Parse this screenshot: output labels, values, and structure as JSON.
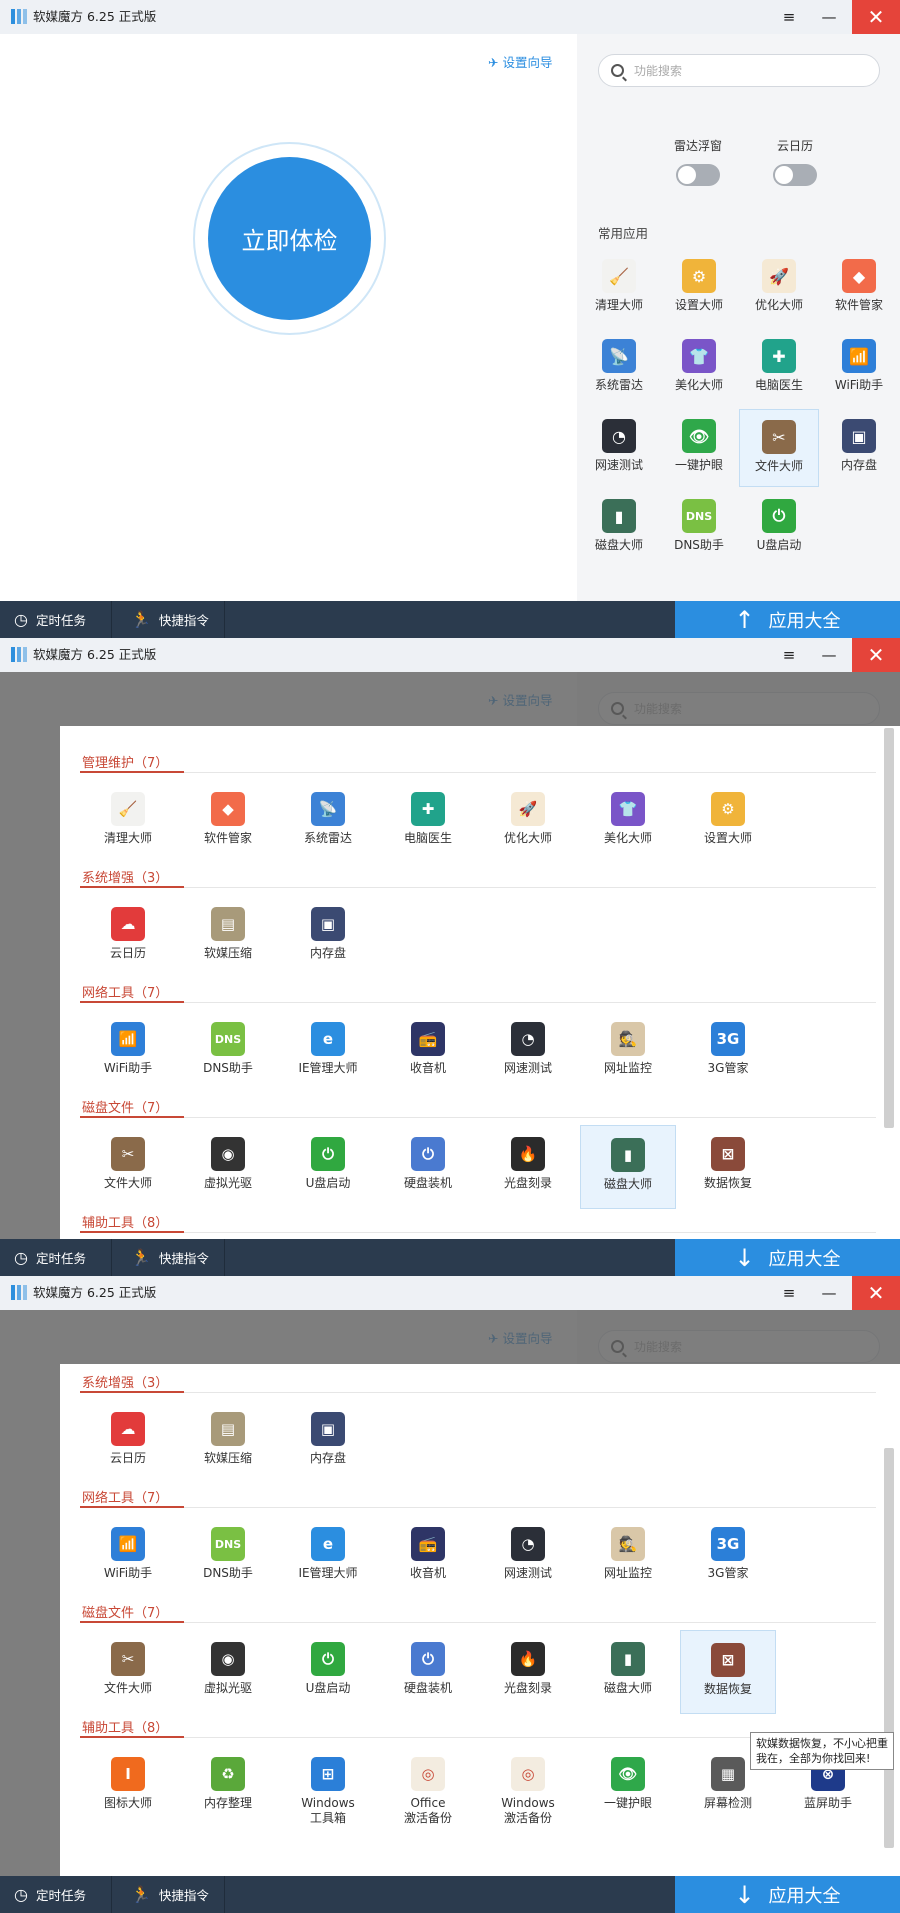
{
  "app": {
    "title": "软媒魔方 6.25 正式版",
    "menu_icon": "≡",
    "min_icon": "—",
    "close_icon": "✕"
  },
  "bottom": {
    "timer": "定时任务",
    "quick": "快捷指令",
    "apps": "应用大全"
  },
  "home": {
    "settings_guide": "设置向导",
    "search_placeholder": "功能搜索",
    "check_button": "立即体检",
    "toggles": [
      {
        "label": "雷达浮窗"
      },
      {
        "label": "云日历"
      }
    ],
    "common_label": "常用应用",
    "common_apps": [
      {
        "label": "清理大师",
        "icon": "broom-icon",
        "color": "#f2f2f0",
        "glyph": "🧹"
      },
      {
        "label": "设置大师",
        "icon": "gear-icon",
        "color": "#f0b43a",
        "glyph": "⚙"
      },
      {
        "label": "优化大师",
        "icon": "rocket-icon",
        "color": "#f5e9d4",
        "glyph": "🚀"
      },
      {
        "label": "软件管家",
        "icon": "diamond-icon",
        "color": "#f26b4a",
        "glyph": "◆"
      },
      {
        "label": "系统雷达",
        "icon": "satellite-icon",
        "color": "#3c82d6",
        "glyph": "📡"
      },
      {
        "label": "美化大师",
        "icon": "tshirt-icon",
        "color": "#7a55c8",
        "glyph": "👕"
      },
      {
        "label": "电脑医生",
        "icon": "medkit-icon",
        "color": "#21a38b",
        "glyph": "✚"
      },
      {
        "label": "WiFi助手",
        "icon": "wifi-icon",
        "color": "#2e7fd8",
        "glyph": "📶"
      },
      {
        "label": "网速测试",
        "icon": "speedometer-icon",
        "color": "#2b2f38",
        "glyph": "◔"
      },
      {
        "label": "一键护眼",
        "icon": "eye-icon",
        "color": "#2fa84a",
        "glyph": "👁"
      },
      {
        "label": "文件大师",
        "icon": "scissors-icon",
        "color": "#8a6a4a",
        "glyph": "✂"
      },
      {
        "label": "内存盘",
        "icon": "chip-icon",
        "color": "#3b4a72",
        "glyph": "▣"
      },
      {
        "label": "磁盘大师",
        "icon": "disk-icon",
        "color": "#3b6f58",
        "glyph": "▮"
      },
      {
        "label": "DNS助手",
        "icon": "dns-icon",
        "color": "#7ac043",
        "glyph": "DNS"
      },
      {
        "label": "U盘启动",
        "icon": "usb-icon",
        "color": "#30a840",
        "glyph": "⏻"
      }
    ]
  },
  "sections": [
    {
      "title": "管理维护（7）",
      "apps": [
        {
          "label": "清理大师",
          "icon": "broom-icon",
          "color": "#f2f2f0",
          "glyph": "🧹"
        },
        {
          "label": "软件管家",
          "icon": "diamond-icon",
          "color": "#f26b4a",
          "glyph": "◆"
        },
        {
          "label": "系统雷达",
          "icon": "satellite-icon",
          "color": "#3c82d6",
          "glyph": "📡"
        },
        {
          "label": "电脑医生",
          "icon": "medkit-icon",
          "color": "#21a38b",
          "glyph": "✚"
        },
        {
          "label": "优化大师",
          "icon": "rocket-icon",
          "color": "#f5e9d4",
          "glyph": "🚀"
        },
        {
          "label": "美化大师",
          "icon": "tshirt-icon",
          "color": "#7a55c8",
          "glyph": "👕"
        },
        {
          "label": "设置大师",
          "icon": "gear-icon",
          "color": "#f0b43a",
          "glyph": "⚙"
        }
      ]
    },
    {
      "title": "系统增强（3）",
      "apps": [
        {
          "label": "云日历",
          "icon": "cloud-calendar-icon",
          "color": "#e23b3b",
          "glyph": "☁"
        },
        {
          "label": "软媒压缩",
          "icon": "archive-icon",
          "color": "#a89a7a",
          "glyph": "▤"
        },
        {
          "label": "内存盘",
          "icon": "chip-icon",
          "color": "#3b4a72",
          "glyph": "▣"
        }
      ]
    },
    {
      "title": "网络工具（7）",
      "apps": [
        {
          "label": "WiFi助手",
          "icon": "wifi-icon",
          "color": "#2e7fd8",
          "glyph": "📶"
        },
        {
          "label": "DNS助手",
          "icon": "dns-icon",
          "color": "#7ac043",
          "glyph": "DNS"
        },
        {
          "label": "IE管理大师",
          "icon": "ie-icon",
          "color": "#2b8ee0",
          "glyph": "e"
        },
        {
          "label": "收音机",
          "icon": "radio-icon",
          "color": "#2e3566",
          "glyph": "📻"
        },
        {
          "label": "网速测试",
          "icon": "speedometer-icon",
          "color": "#2b2f38",
          "glyph": "◔"
        },
        {
          "label": "网址监控",
          "icon": "spy-icon",
          "color": "#d9c7a8",
          "glyph": "🕵"
        },
        {
          "label": "3G管家",
          "icon": "3g-icon",
          "color": "#2b7fd8",
          "glyph": "3G"
        }
      ]
    },
    {
      "title": "磁盘文件（7）",
      "apps": [
        {
          "label": "文件大师",
          "icon": "scissors-icon",
          "color": "#8a6a4a",
          "glyph": "✂"
        },
        {
          "label": "虚拟光驱",
          "icon": "disc-icon",
          "color": "#333",
          "glyph": "◉"
        },
        {
          "label": "U盘启动",
          "icon": "usb-icon",
          "color": "#30a840",
          "glyph": "⏻"
        },
        {
          "label": "硬盘装机",
          "icon": "harddisk-icon",
          "color": "#4a7ad0",
          "glyph": "⏻"
        },
        {
          "label": "光盘刻录",
          "icon": "fire-disc-icon",
          "color": "#2b2b2b",
          "glyph": "🔥"
        },
        {
          "label": "磁盘大师",
          "icon": "disk-icon",
          "color": "#3b6f58",
          "glyph": "▮"
        },
        {
          "label": "数据恢复",
          "icon": "recovery-icon",
          "color": "#8a4a3a",
          "glyph": "⊠"
        }
      ]
    },
    {
      "title": "辅助工具（8）",
      "apps": [
        {
          "label": "图标大师",
          "icon": "icon-master-icon",
          "color": "#f06a1e",
          "glyph": "I"
        },
        {
          "label": "内存整理",
          "icon": "memory-icon",
          "color": "#5aa83a",
          "glyph": "♻"
        },
        {
          "label": "Windows\n工具箱",
          "icon": "toolbox-icon",
          "color": "#2b7fd8",
          "glyph": "⊞"
        },
        {
          "label": "Office\n激活备份",
          "icon": "office-icon",
          "color": "#f3ece0",
          "glyph": "◎"
        },
        {
          "label": "Windows\n激活备份",
          "icon": "windows-backup-icon",
          "color": "#f3ece0",
          "glyph": "◎"
        },
        {
          "label": "一键护眼",
          "icon": "eye-icon",
          "color": "#2fa84a",
          "glyph": "👁"
        },
        {
          "label": "屏幕检测",
          "icon": "monitor-icon",
          "color": "#5a5a5a",
          "glyph": "▦"
        },
        {
          "label": "蓝屏助手",
          "icon": "bsod-icon",
          "color": "#1e3a8a",
          "glyph": "⊗"
        }
      ]
    }
  ],
  "tooltip": {
    "line1": "软媒数据恢复，不小心把重",
    "line2": "我在，全部为你找回来!"
  }
}
